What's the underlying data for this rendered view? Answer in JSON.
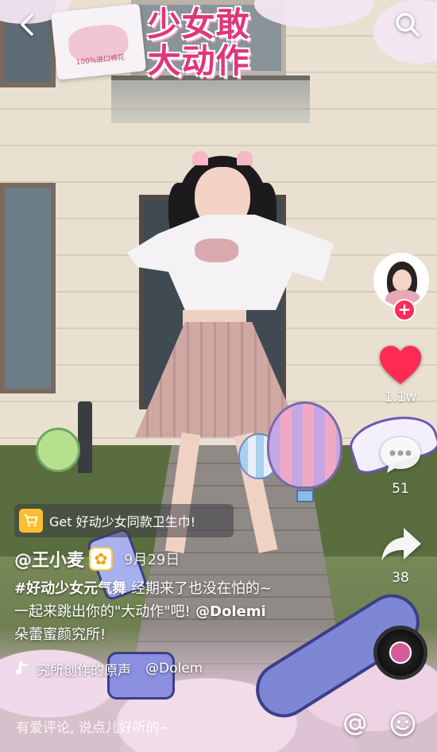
{
  "campaign": {
    "title_line1": "少女敢",
    "title_line2": "大动作",
    "product_box_text": "100%进口棉花"
  },
  "top_bar": {
    "back_icon": "chevron-left-icon",
    "search_icon": "search-icon"
  },
  "rail": {
    "follow_label": "+",
    "like_count": "1.1w",
    "comment_count": "51",
    "share_count": "38",
    "colors": {
      "like": "#fe2c55",
      "follow": "#fe2c55"
    }
  },
  "product_link": {
    "text": "Get 好动少女同款卫生巾!",
    "icon": "shopping-cart-icon"
  },
  "author": {
    "handle": "@王小麦",
    "badge_icon": "sunflower-icon",
    "badge_glyph": "✿",
    "date": "9月29日"
  },
  "caption": {
    "hashtag": "#好动少女元气舞",
    "line1_rest": " 经期来了也没在怕的~",
    "line2_text": "一起来跳出你的\"大动作\"吧!",
    "mention": " @Dolemi",
    "line3": "朵蕾蜜颜究所!"
  },
  "sound": {
    "title": "究所创作的原声",
    "mention": "@Dolem"
  },
  "comment_bar": {
    "placeholder": "有爱评论, 说点儿好听的~",
    "at_icon": "at-sign-icon",
    "emoji_icon": "emoji-icon"
  }
}
